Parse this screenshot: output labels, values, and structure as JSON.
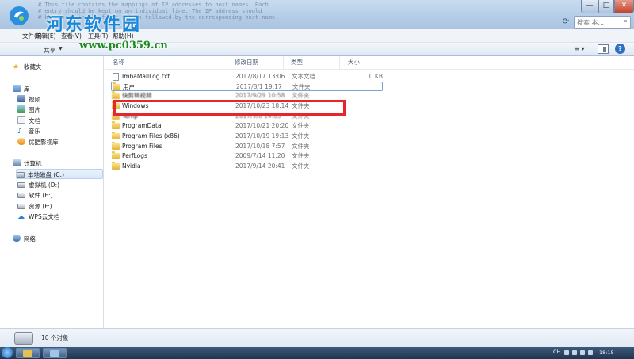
{
  "window": {
    "background_text": [
      "# This file contains the mappings of IP addresses to host names. Each",
      "# entry should be kept on an individual line. The IP address should",
      "# be placed in the first column followed by the corresponding host name."
    ],
    "btn_min": "—",
    "btn_max": "□",
    "btn_close": "✕"
  },
  "watermark": {
    "brand": "河东软件园",
    "url": "www.pc0359.cn"
  },
  "search": {
    "placeholder": "搜索 本..."
  },
  "menubar": {
    "items": [
      "文件(F)",
      "编辑(E)",
      "查看(V)",
      "工具(T)",
      "帮助(H)"
    ]
  },
  "cmdbar": {
    "share": "共享",
    "view_icon": "≡ ▾"
  },
  "nav": {
    "favorites": "收藏夹",
    "library": "库",
    "library_items": [
      "视频",
      "图片",
      "文档",
      "音乐",
      "优酷影视库"
    ],
    "computer": "计算机",
    "drives": [
      "本地磁盘 (C:)",
      "虚拟机 (D:)",
      "软件 (E:)",
      "资源 (F:)",
      "WPS云文档"
    ],
    "network": "网络"
  },
  "columns": {
    "name": "名称",
    "date": "修改日期",
    "type": "类型",
    "size": "大小"
  },
  "files": [
    {
      "name": "ImbaMallLog.txt",
      "date": "2017/8/17 13:06",
      "type": "文本文档",
      "size": "0 KB"
    },
    {
      "name": "用户",
      "date": "2017/8/1 19:17",
      "type": "文件夹",
      "size": ""
    },
    {
      "name": "快剪辑视频",
      "date": "2017/9/29 10:58",
      "type": "文件夹",
      "size": ""
    },
    {
      "name": "Windows",
      "date": "2017/10/23 18:14",
      "type": "文件夹",
      "size": ""
    },
    {
      "name": "Temp",
      "date": "2017/9/6 14:05",
      "type": "文件夹",
      "size": ""
    },
    {
      "name": "ProgramData",
      "date": "2017/10/21 20:20",
      "type": "文件夹",
      "size": ""
    },
    {
      "name": "Program Files (x86)",
      "date": "2017/10/19 19:13",
      "type": "文件夹",
      "size": ""
    },
    {
      "name": "Program Files",
      "date": "2017/10/18 7:57",
      "type": "文件夹",
      "size": ""
    },
    {
      "name": "PerfLogs",
      "date": "2009/7/14 11:20",
      "type": "文件夹",
      "size": ""
    },
    {
      "name": "Nvidia",
      "date": "2017/9/14 20:41",
      "type": "文件夹",
      "size": ""
    }
  ],
  "status": {
    "count": "10 个对象"
  },
  "taskbar": {
    "lang": "CH",
    "clock": "18:15"
  },
  "colors": {
    "highlight": "#e5262b",
    "brand": "#1a87d8",
    "url": "#1e8a22"
  }
}
